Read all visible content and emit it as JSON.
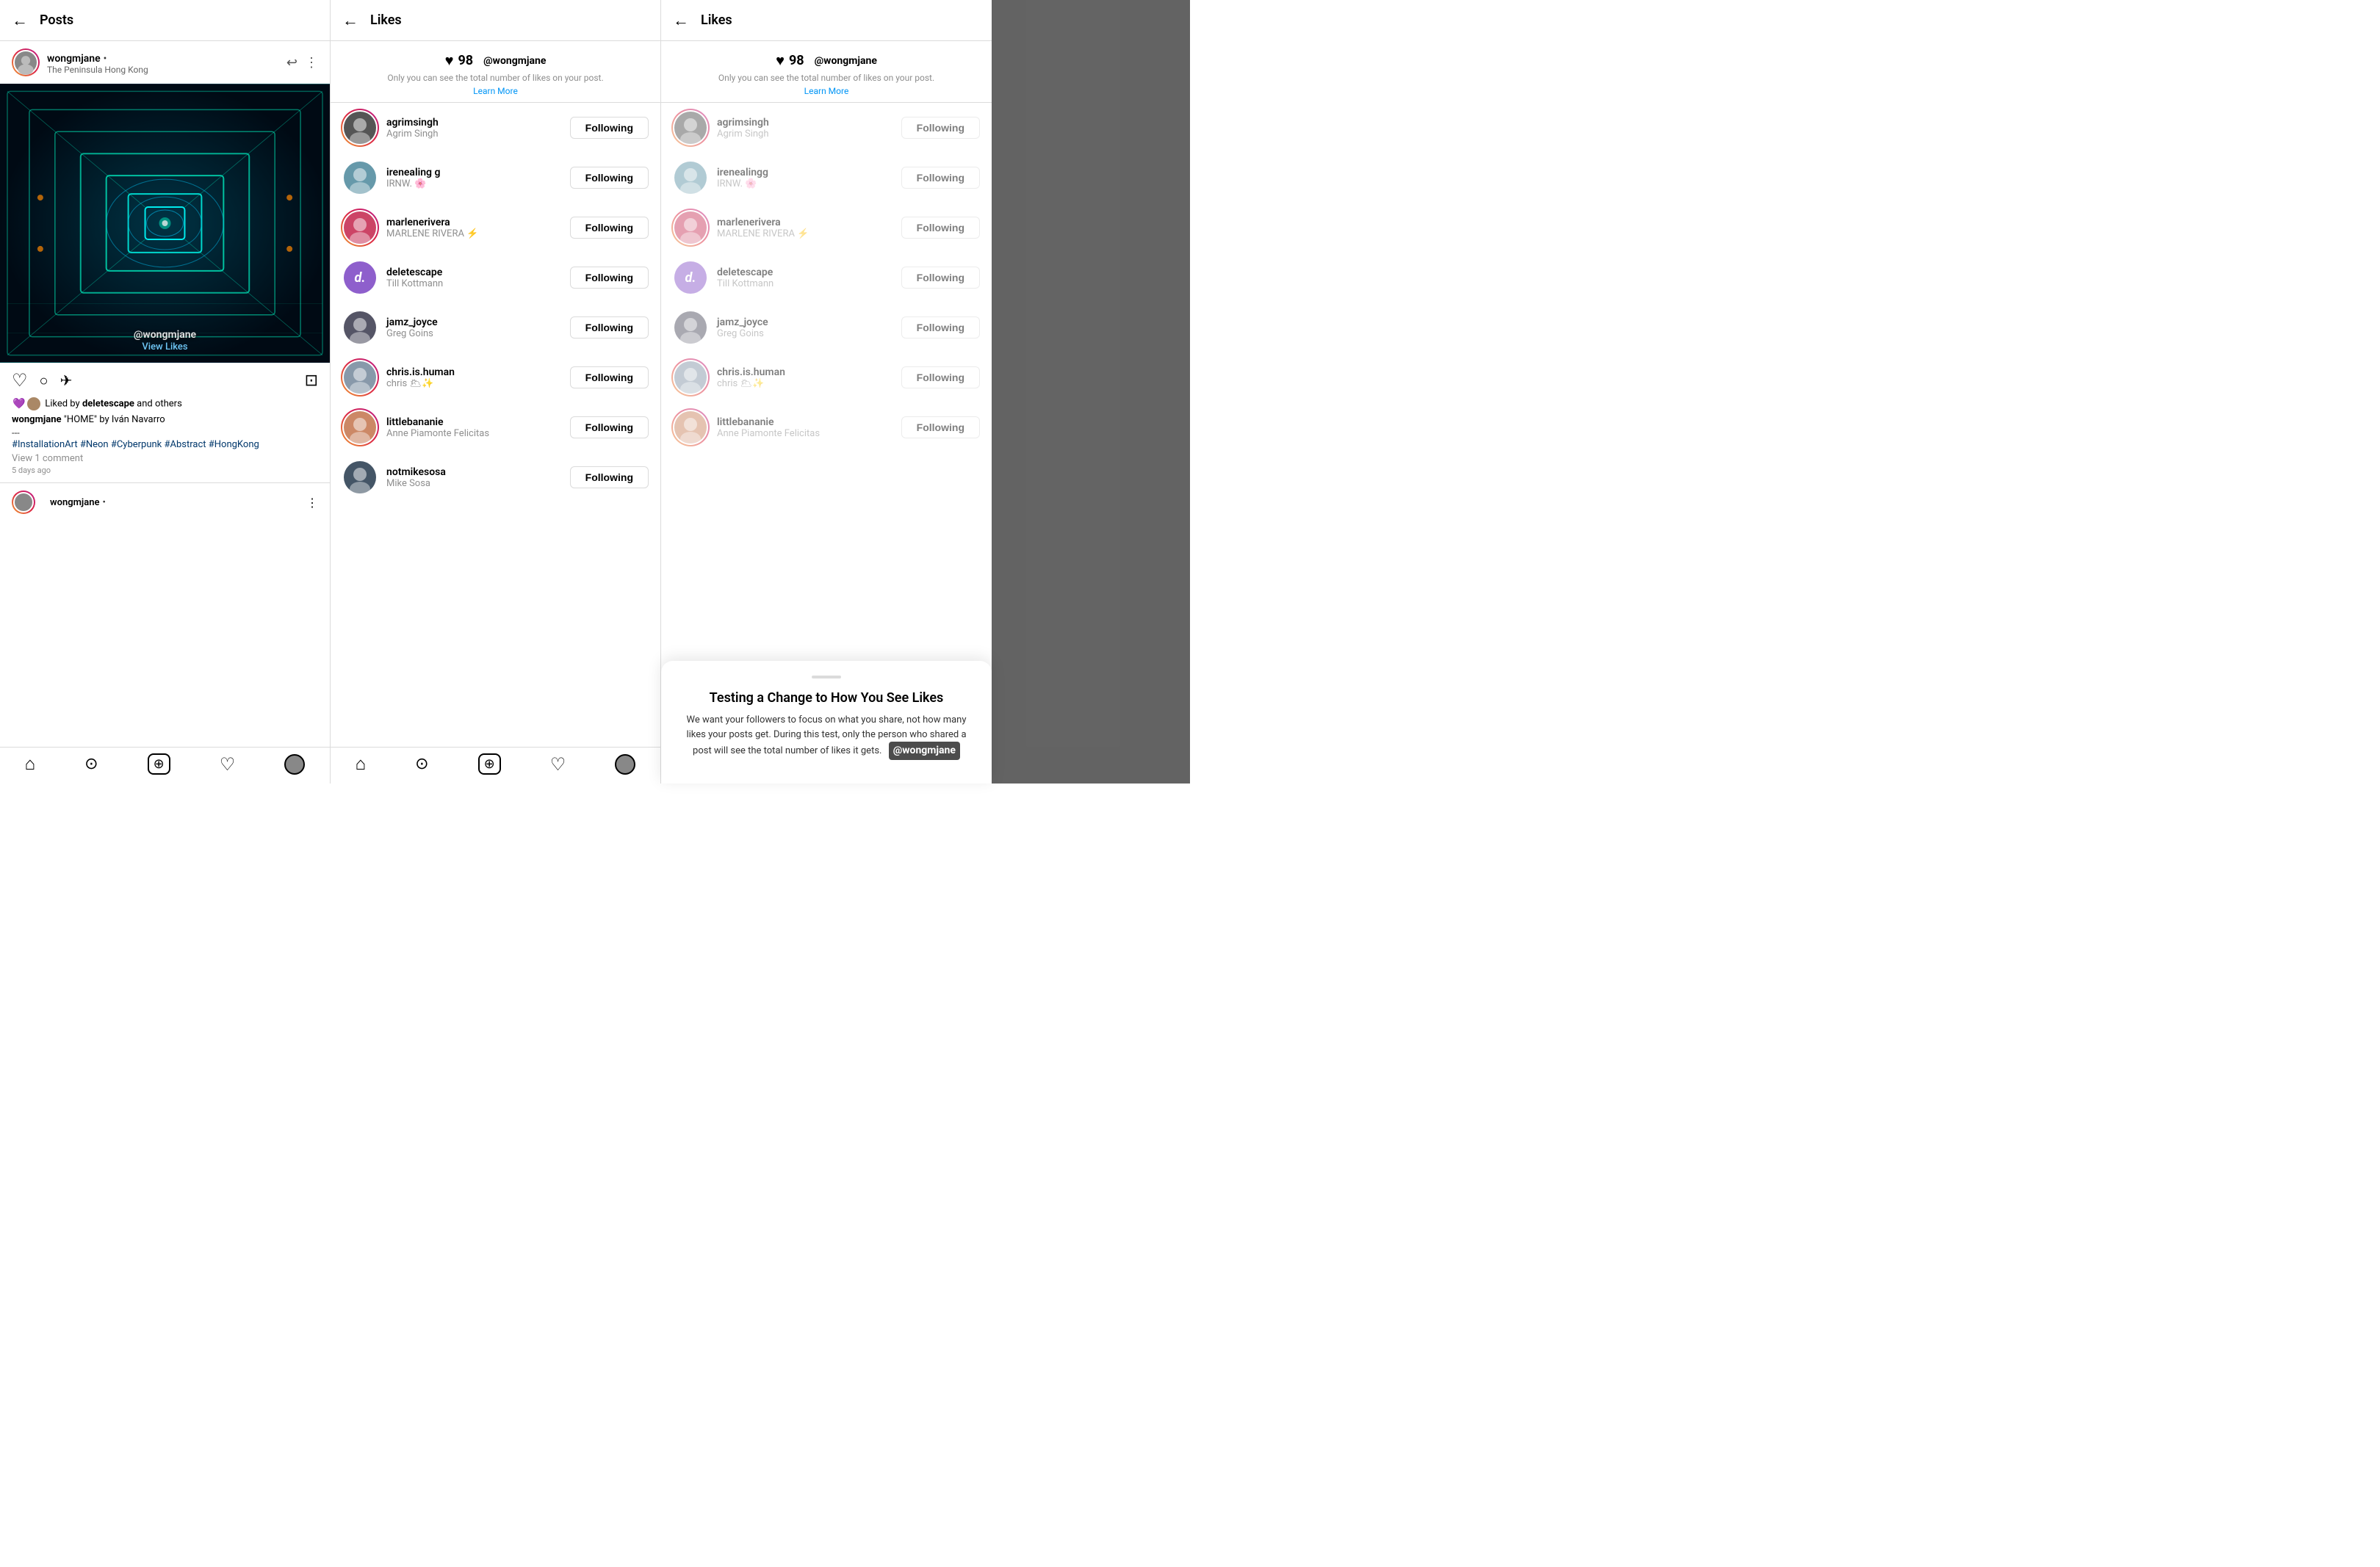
{
  "panels": {
    "left": {
      "header": {
        "back_icon": "←",
        "title": "Posts"
      },
      "post": {
        "username": "wongmjane",
        "dot": "•",
        "subtitle": "The Peninsula Hong Kong",
        "watermark": "@wongmjane",
        "view_likes": "View Likes",
        "icons": {
          "heart": "♡",
          "comment": "○",
          "share": "✈",
          "bookmark": "⊡"
        },
        "liked_by": "Liked by",
        "liked_user": "deletescape",
        "liked_suffix": "and others",
        "caption_user": "wongmjane",
        "caption_text": "\"HOME\" by Iván Navarro",
        "caption_sep": "---",
        "hashtags": "#InstallationArt #Neon #Cyberpunk #Abstract #HongKong",
        "comments": "View 1 comment",
        "time": "5 days ago",
        "second_post_user": "wongmjane",
        "second_post_dot": "•"
      },
      "bottom_nav": [
        "⌂",
        "⊙",
        "⊕",
        "♡",
        "◉"
      ]
    },
    "middle": {
      "header": {
        "back_icon": "←",
        "title": "Likes"
      },
      "likes_section": {
        "heart": "♥",
        "count": "98",
        "watermark": "@wongmjane",
        "note": "Only you can see the total number of likes on your post.",
        "learn_more": "Learn More"
      },
      "users": [
        {
          "handle": "agrimsingh",
          "name": "Agrim Singh",
          "follow": "Following",
          "avatar_type": "photo",
          "avatar_color": "#555",
          "has_ring": true
        },
        {
          "handle": "irenealing g",
          "name": "IRNW. 🌸",
          "follow": "Following",
          "avatar_type": "photo",
          "avatar_color": "#6699aa",
          "has_ring": false
        },
        {
          "handle": "marlenerivera",
          "name": "MARLENE RIVERA ⚡",
          "follow": "Following",
          "avatar_type": "photo",
          "avatar_color": "#cc4466",
          "has_ring": true
        },
        {
          "handle": "deletescape",
          "name": "Till Kottmann",
          "follow": "Following",
          "avatar_type": "letter",
          "avatar_letter": "d.",
          "avatar_color": "#8e5fcc",
          "has_ring": false
        },
        {
          "handle": "jamz_joyce",
          "name": "Greg Goins",
          "follow": "Following",
          "avatar_type": "photo",
          "avatar_color": "#555566",
          "has_ring": false
        },
        {
          "handle": "chris.is.human",
          "name": "chris 🌥✨",
          "follow": "Following",
          "avatar_type": "photo",
          "avatar_color": "#8899aa",
          "has_ring": true
        },
        {
          "handle": "littlebananie",
          "name": "Anne Piamonte Felicitas",
          "follow": "Following",
          "avatar_type": "photo",
          "avatar_color": "#cc8866",
          "has_ring": true
        },
        {
          "handle": "notmikesosa",
          "name": "Mike Sosa",
          "follow": "Following",
          "avatar_type": "photo",
          "avatar_color": "#445566",
          "has_ring": false
        }
      ],
      "bottom_nav": [
        "⌂",
        "⊙",
        "⊕",
        "♡",
        "◉"
      ]
    },
    "right": {
      "header": {
        "back_icon": "←",
        "title": "Likes"
      },
      "likes_section": {
        "heart": "♥",
        "count": "98",
        "watermark": "@wongmjane",
        "note": "Only you can see the total number of likes on your post.",
        "learn_more": "Learn More"
      },
      "users": [
        {
          "handle": "agrimsingh",
          "name": "Agrim Singh",
          "follow": "Following",
          "avatar_type": "photo",
          "avatar_color": "#555",
          "has_ring": true
        },
        {
          "handle": "irenealingg",
          "name": "IRNW. 🌸",
          "follow": "Following",
          "avatar_type": "photo",
          "avatar_color": "#6699aa",
          "has_ring": false
        },
        {
          "handle": "marlenerivera",
          "name": "MARLENE RIVERA ⚡",
          "follow": "Following",
          "avatar_type": "photo",
          "avatar_color": "#cc4466",
          "has_ring": true
        },
        {
          "handle": "deletescape",
          "name": "Till Kottmann",
          "follow": "Following",
          "avatar_type": "letter",
          "avatar_letter": "d.",
          "avatar_color": "#8e5fcc",
          "has_ring": false
        },
        {
          "handle": "jamz_joyce",
          "name": "Greg Goins",
          "follow": "Following",
          "avatar_type": "photo",
          "avatar_color": "#555566",
          "has_ring": false
        },
        {
          "handle": "chris.is.human",
          "name": "chris 🌥✨",
          "follow": "Following",
          "avatar_type": "photo",
          "avatar_color": "#8899aa",
          "has_ring": true
        },
        {
          "handle": "littlebananie",
          "name": "Anne Piamonte Felicitas",
          "follow": "Following",
          "avatar_type": "photo",
          "avatar_color": "#cc8866",
          "has_ring": true
        }
      ],
      "bottom_sheet": {
        "title": "Testing a Change to How You See Likes",
        "text": "We want your followers to focus on what you share, not how many likes your posts get. During this test, only the person who shared a post will see the total number of likes it gets.",
        "watermark": "@wongmjane"
      }
    }
  }
}
